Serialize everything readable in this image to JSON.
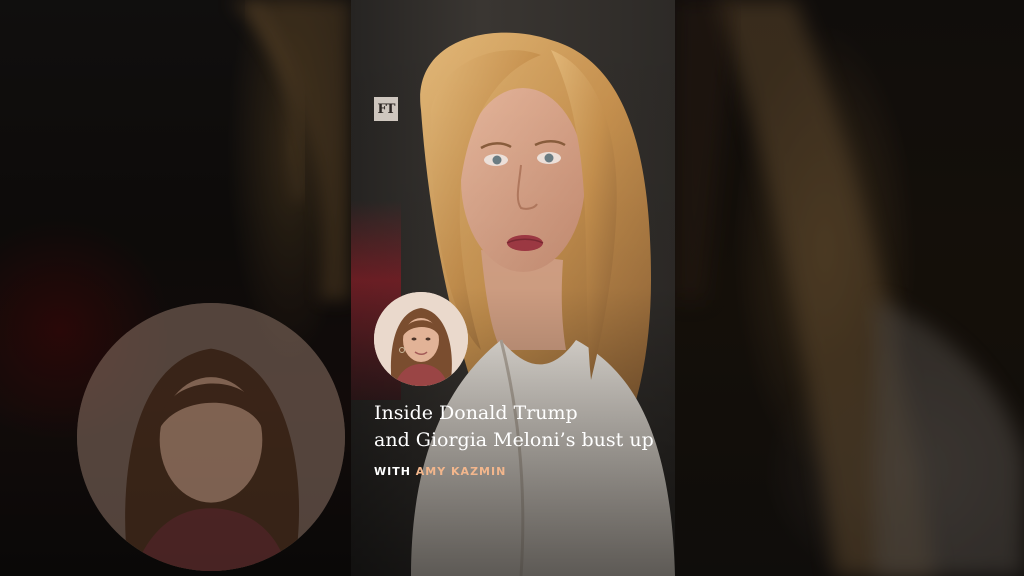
{
  "brand": {
    "logo_text": "FT"
  },
  "episode": {
    "title_line_1": "Inside Donald Trump",
    "title_line_2": "and Giorgia Meloni’s bust up",
    "byline_prefix": "WITH",
    "byline_author": "AMY KAZMIN"
  },
  "colors": {
    "title": "#ffffff",
    "author_accent": "#f2b68c",
    "logo_bg": "#cfc7bf"
  }
}
